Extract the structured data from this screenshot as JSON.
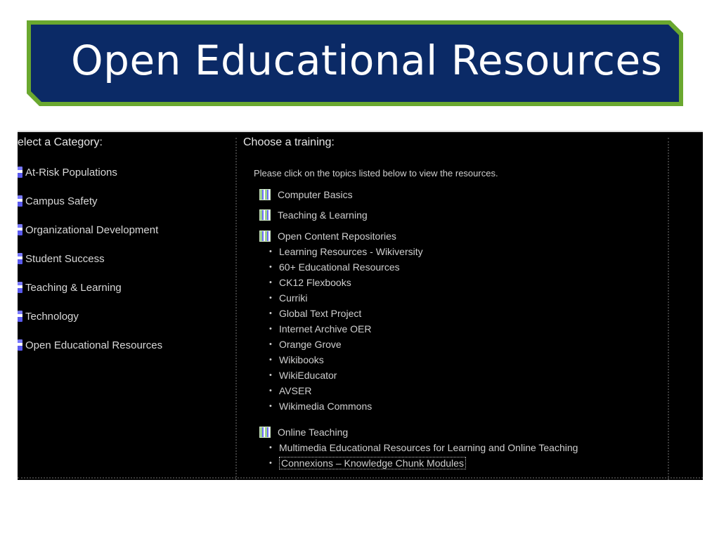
{
  "slide": {
    "title": "Open Educational Resources",
    "colors": {
      "banner_fill": "#0b2a66",
      "banner_border": "#6aa82f",
      "panel_bg": "#000000"
    }
  },
  "categories": {
    "heading": "elect a Category:",
    "items": [
      {
        "label": "At-Risk Populations",
        "icon": "category-bullet-icon"
      },
      {
        "label": "Campus Safety",
        "icon": "category-bullet-icon"
      },
      {
        "label": "Organizational Development",
        "icon": "category-bullet-icon"
      },
      {
        "label": "Student Success",
        "icon": "category-bullet-icon"
      },
      {
        "label": "Teaching & Learning",
        "icon": "category-bullet-icon"
      },
      {
        "label": "Technology",
        "icon": "category-bullet-icon"
      },
      {
        "label": "Open Educational Resources",
        "icon": "category-bullet-icon"
      }
    ]
  },
  "training": {
    "heading": "Choose a training:",
    "instruction": "Please click on the topics listed below to view the resources.",
    "topics": [
      {
        "label": "Computer Basics",
        "icon": "folder-icon"
      },
      {
        "label": "Teaching & Learning",
        "icon": "folder-icon"
      },
      {
        "label": "Open Content Repositories",
        "icon": "folder-icon"
      },
      {
        "label": "Online Teaching",
        "icon": "folder-icon"
      }
    ],
    "repositories": [
      "Learning Resources - Wikiversity",
      "60+ Educational Resources",
      "CK12 Flexbooks",
      "Curriki",
      "Global Text Project",
      "Internet Archive OER",
      "Orange Grove",
      "Wikibooks",
      "WikiEducator",
      "AVSER",
      "Wikimedia Commons"
    ],
    "online_teaching": [
      "Multimedia Educational Resources for Learning and Online Teaching",
      "Connexions – Knowledge Chunk Modules"
    ]
  }
}
